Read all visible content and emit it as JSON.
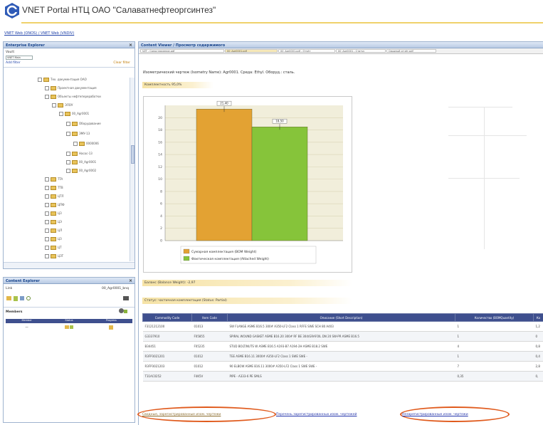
{
  "header": {
    "title": "VNET Portal НТЦ ОАО \"Салаватнефтеоргсинтез\"",
    "breadcrumb": "VNET Web (ONOS) / VNET Web (VNDIV)"
  },
  "enterprise_explorer": {
    "title": "Enterprise Explorer",
    "close": "×",
    "filter_label": "Vault:",
    "filter_value": "VNET Main",
    "add_label": "Add filter",
    "clear_label": "Clear filter",
    "tree": [
      "Тех. документация ОАО",
      "Проектная документация",
      "Объекты нефтепереработки",
      "ЭЛОУ",
      "00_Agr0001",
      "Оборудование",
      "ЭМУ-13",
      "0000006",
      "Насос-13",
      "00_Agr0001",
      "00_Agr0002",
      "TTA",
      "TTB",
      "ЦТЛ",
      "ЦПФ",
      "ЦЗ",
      "ЦЭ",
      "ЦЛ",
      "ЦЗ",
      "ЦТ",
      "ЦЗТ",
      "ЦМ"
    ]
  },
  "content_explorer_left": {
    "title": "Content Explorer",
    "close": "×",
    "row_label": "Link",
    "row_value": "00_Agr0001_bnq",
    "section_label": "Members",
    "columns": [
      "Member",
      "Status",
      "Progress"
    ],
    "row": [
      "—",
      "",
      ""
    ]
  },
  "content_viewer": {
    "title": "Content Viewer / Просмотр содержимого",
    "tabs": [
      "VZT - Сопоставление.pdf",
      "00_Agr0001.pdf",
      "00_Agr0001.pdf - Отчёт",
      "00_Agr0001 - Статус",
      "Сводный отчёт.pdf"
    ],
    "active_tab_index": 1,
    "description": "Изометрический чертеж (Isometry Name): Agr0001. Среда: Ethyl. Оборуд.: сталь.",
    "completeness_label": "Комплектность 95,0%",
    "balance_label": "Баланс (Balance Weight): -2,97",
    "status_label": "Статус: частичная комплектация (Status: Partial)",
    "table_headers": [
      "Commodity Code",
      "Item Code",
      "Описание (Short Description)",
      "Количество (BOMQuantity)",
      "Ко"
    ],
    "table_rows": [
      [
        "F3121212100",
        "01013",
        "SW FLANGE ASME B16.5 300# A350-LF2 Class 1 RFFE SWE SCH 80 A403",
        "1",
        "1,2"
      ],
      [
        "G3337910",
        "F05855",
        "SPIRAL WOUND GASKET ASME B16.20 300# RF BE 304/GRAFOIL DN 20 SW-PR ASME B16.5",
        "1",
        "0"
      ],
      [
        "B34451",
        "F05235",
        "STUD BOLT/NUTS W ASME B16.5 A193-B7 A194-2H ASME B18.2 SWE",
        "4",
        "0,8"
      ],
      [
        "R3FP3021201",
        "01012",
        "TEE ASME B16.11 3000# A350-LF2 Class 1 SWE SWE -",
        "1",
        "0,4"
      ],
      [
        "R3FP3021203",
        "01012",
        "90 ELBOW ASME B16.11 3000# A350-LF2 Class 1 SWE SWE -",
        "7",
        "2,8"
      ],
      [
        "T31AC0252",
        "F4K5V",
        "PIPE - A333-6 PE SMLS",
        "0,35",
        "0,"
      ]
    ],
    "bottom_links": [
      "Сводные, зарегистрированные изом. чертежи",
      "Перечень зарегистрированных изом. чертежей",
      "Незарегистрированные изом. чертежи"
    ]
  },
  "chart_data": {
    "type": "bar",
    "categories": [
      "Сумарная комплектация (BOM Weight)",
      "Фактическая комплектация (Attached Weight)"
    ],
    "values": [
      21.4,
      18.5
    ],
    "value_labels": [
      "21,40",
      "18,50"
    ],
    "ylim": [
      0,
      22
    ],
    "yticks": [
      0,
      2,
      4,
      6,
      8,
      10,
      12,
      14,
      16,
      18,
      20
    ],
    "series_colors": [
      "#e3a233",
      "#86c43a"
    ],
    "legend": [
      "Сумарная комплектация (BOM Weight)",
      "Фактическая комплектация (Attached Weight)"
    ],
    "legend_position": "bottom",
    "grid": true
  },
  "colors": {
    "header_rule": "#f0d16b",
    "table_header": "#3e4f8e",
    "annotation_oval": "#e05a1c",
    "chart_bg": "#f1eedb"
  }
}
